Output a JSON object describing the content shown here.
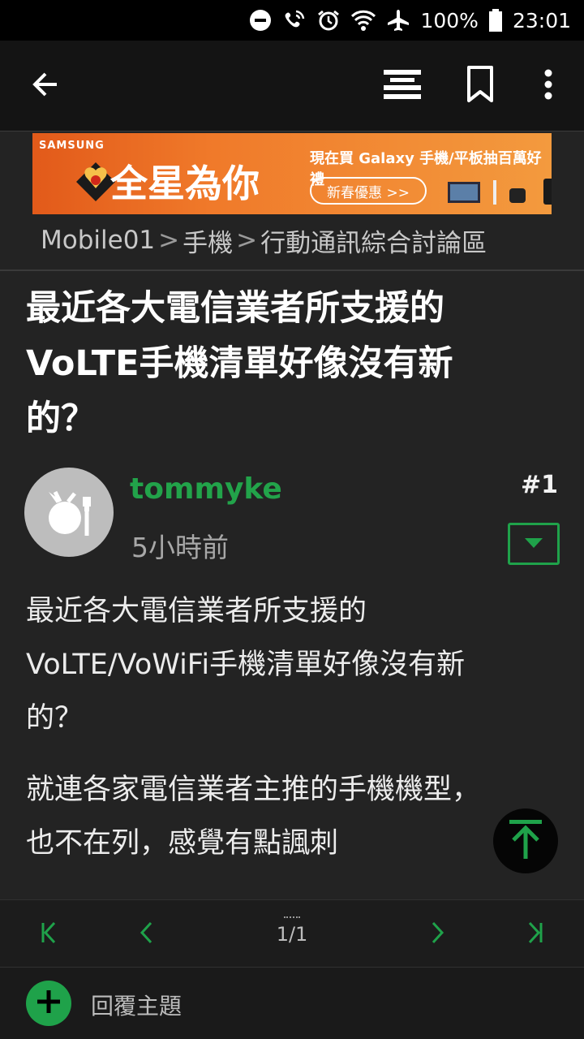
{
  "status_bar": {
    "battery": "100%",
    "time": "23:01",
    "icons": [
      "do-not-disturb-icon",
      "wifi-calling-icon",
      "alarm-icon",
      "wifi-icon",
      "airplane-icon",
      "battery-icon"
    ]
  },
  "app_bar": {
    "icons": [
      "back-arrow-icon",
      "list-menu-icon",
      "bookmark-icon",
      "more-vert-icon"
    ]
  },
  "banner": {
    "brand": "SAMSUNG",
    "title": "全星為你",
    "promo": "現在買 Galaxy 手機/平板抽百萬好禮",
    "button": "新春優惠 >>"
  },
  "breadcrumb": {
    "items": [
      "Mobile01",
      "手機",
      "行動通訊綜合討論區"
    ],
    "separator": ">"
  },
  "post": {
    "title": "最近各大電信業者所支援的VoLTE手機清單好像沒有新的？",
    "title_lines": [
      "最近各大電信業者所支援的",
      "VoLTE手機清單好像沒有新",
      "的？"
    ],
    "author": "tommyke",
    "time": "5小時前",
    "number": "#1",
    "paragraphs": [
      "最近各大電信業者所支援的\nVoLTE/VoWiFi手機清單好像沒有新\n的？",
      "就連各家電信業者主推的手機機型，\n也不在列，感覺有點諷刺"
    ]
  },
  "pagination": {
    "page": "1/1",
    "icons": [
      "first-page-icon",
      "prev-page-icon",
      "next-page-icon",
      "last-page-icon"
    ]
  },
  "reply": {
    "label": "回覆主題"
  },
  "colors": {
    "accent_green": "#1fa24a",
    "username_green": "#22a34a",
    "background": "#232323",
    "app_bar": "#141414",
    "banner_orange": "#f07a2a"
  }
}
